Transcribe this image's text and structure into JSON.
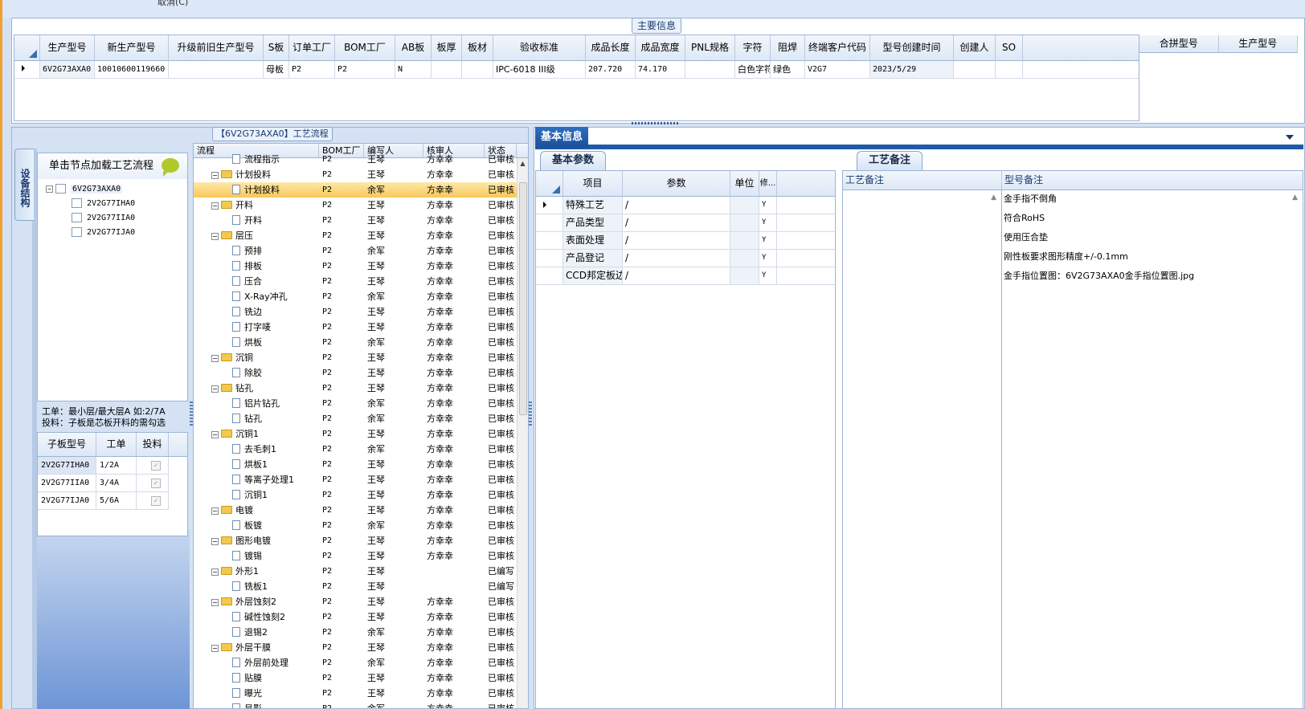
{
  "top": {
    "clipped_text": "取消(C)"
  },
  "main_info": {
    "group_title": "主要信息",
    "columns": [
      "生产型号",
      "新生产型号",
      "升级前旧生产型号",
      "S板",
      "订单工厂",
      "BOM工厂",
      "AB板",
      "板厚",
      "板材",
      "验收标准",
      "成品长度",
      "成品宽度",
      "PNL规格",
      "字符",
      "阻焊",
      "终端客户代码",
      "型号创建时间",
      "创建人",
      "SO"
    ],
    "row": [
      "6V2G73AXA0",
      "10010600119660",
      "",
      "母板",
      "P2",
      "P2",
      "N",
      "",
      "",
      "IPC-6018 III级",
      "207.720",
      "74.170",
      "",
      "白色字符",
      "绿色",
      "V2G7",
      "2023/5/29",
      "",
      ""
    ]
  },
  "merge": {
    "columns": [
      "合拼型号",
      "生产型号"
    ]
  },
  "left": {
    "side_tab": "设备结构",
    "flow_title": "【6V2G73AXA0】工艺流程",
    "node_hint": "单击节点加载工艺流程",
    "tree": {
      "root": "6V2G73AXA0",
      "children": [
        "2V2G77IHA0",
        "2V2G77IIA0",
        "2V2G77IJA0"
      ]
    },
    "notes": [
      "工单：最小层/最大层A 如:2/7A",
      "投料：子板是芯板开料的需勾选"
    ],
    "sub_columns": [
      "子板型号",
      "工单",
      "投料"
    ],
    "sub_rows": [
      {
        "model": "2V2G77IHA0",
        "order": "1/2A",
        "check": "✓"
      },
      {
        "model": "2V2G77IIA0",
        "order": "3/4A",
        "check": "✓"
      },
      {
        "model": "2V2G77IJA0",
        "order": "5/6A",
        "check": "✓"
      }
    ]
  },
  "flow": {
    "columns": [
      "流程",
      "BOM工厂",
      "编写人",
      "核审人",
      "状态"
    ],
    "rows": [
      {
        "name": "流程指示",
        "type": "doc",
        "bom": "P2",
        "writer": "王琴",
        "reviewer": "方幸幸",
        "status": "已审核"
      },
      {
        "name": "计划投料",
        "type": "folder",
        "bom": "P2",
        "writer": "王琴",
        "reviewer": "方幸幸",
        "status": "已审核"
      },
      {
        "name": "计划投料",
        "type": "doc",
        "bom": "P2",
        "writer": "余军",
        "reviewer": "方幸幸",
        "status": "已审核",
        "hl": true
      },
      {
        "name": "开料",
        "type": "folder",
        "bom": "P2",
        "writer": "王琴",
        "reviewer": "方幸幸",
        "status": "已审核"
      },
      {
        "name": "开料",
        "type": "doc",
        "bom": "P2",
        "writer": "王琴",
        "reviewer": "方幸幸",
        "status": "已审核"
      },
      {
        "name": "层压",
        "type": "folder",
        "bom": "P2",
        "writer": "王琴",
        "reviewer": "方幸幸",
        "status": "已审核"
      },
      {
        "name": "预排",
        "type": "doc",
        "bom": "P2",
        "writer": "余军",
        "reviewer": "方幸幸",
        "status": "已审核"
      },
      {
        "name": "排板",
        "type": "doc",
        "bom": "P2",
        "writer": "王琴",
        "reviewer": "方幸幸",
        "status": "已审核"
      },
      {
        "name": "压合",
        "type": "doc",
        "bom": "P2",
        "writer": "王琴",
        "reviewer": "方幸幸",
        "status": "已审核"
      },
      {
        "name": "X-Ray冲孔",
        "type": "doc",
        "bom": "P2",
        "writer": "余军",
        "reviewer": "方幸幸",
        "status": "已审核"
      },
      {
        "name": "铣边",
        "type": "doc",
        "bom": "P2",
        "writer": "王琴",
        "reviewer": "方幸幸",
        "status": "已审核"
      },
      {
        "name": "打字唛",
        "type": "doc",
        "bom": "P2",
        "writer": "王琴",
        "reviewer": "方幸幸",
        "status": "已审核"
      },
      {
        "name": "烘板",
        "type": "doc",
        "bom": "P2",
        "writer": "余军",
        "reviewer": "方幸幸",
        "status": "已审核"
      },
      {
        "name": "沉铜",
        "type": "folder",
        "bom": "P2",
        "writer": "王琴",
        "reviewer": "方幸幸",
        "status": "已审核"
      },
      {
        "name": "除胶",
        "type": "doc",
        "bom": "P2",
        "writer": "王琴",
        "reviewer": "方幸幸",
        "status": "已审核"
      },
      {
        "name": "钻孔",
        "type": "folder",
        "bom": "P2",
        "writer": "王琴",
        "reviewer": "方幸幸",
        "status": "已审核"
      },
      {
        "name": "铝片钻孔",
        "type": "doc",
        "bom": "P2",
        "writer": "余军",
        "reviewer": "方幸幸",
        "status": "已审核"
      },
      {
        "name": "钻孔",
        "type": "doc",
        "bom": "P2",
        "writer": "余军",
        "reviewer": "方幸幸",
        "status": "已审核"
      },
      {
        "name": "沉铜1",
        "type": "folder",
        "bom": "P2",
        "writer": "王琴",
        "reviewer": "方幸幸",
        "status": "已审核"
      },
      {
        "name": "去毛刺1",
        "type": "doc",
        "bom": "P2",
        "writer": "余军",
        "reviewer": "方幸幸",
        "status": "已审核"
      },
      {
        "name": "烘板1",
        "type": "doc",
        "bom": "P2",
        "writer": "王琴",
        "reviewer": "方幸幸",
        "status": "已审核"
      },
      {
        "name": "等离子处理1",
        "type": "doc",
        "bom": "P2",
        "writer": "王琴",
        "reviewer": "方幸幸",
        "status": "已审核"
      },
      {
        "name": "沉铜1",
        "type": "doc",
        "bom": "P2",
        "writer": "王琴",
        "reviewer": "方幸幸",
        "status": "已审核"
      },
      {
        "name": "电镀",
        "type": "folder",
        "bom": "P2",
        "writer": "王琴",
        "reviewer": "方幸幸",
        "status": "已审核"
      },
      {
        "name": "板镀",
        "type": "doc",
        "bom": "P2",
        "writer": "余军",
        "reviewer": "方幸幸",
        "status": "已审核"
      },
      {
        "name": "图形电镀",
        "type": "folder",
        "bom": "P2",
        "writer": "王琴",
        "reviewer": "方幸幸",
        "status": "已审核"
      },
      {
        "name": "镀锡",
        "type": "doc",
        "bom": "P2",
        "writer": "王琴",
        "reviewer": "方幸幸",
        "status": "已审核"
      },
      {
        "name": "外形1",
        "type": "folder",
        "bom": "P2",
        "writer": "王琴",
        "reviewer": "",
        "status": "已编写"
      },
      {
        "name": "铣板1",
        "type": "doc",
        "bom": "P2",
        "writer": "王琴",
        "reviewer": "",
        "status": "已编写"
      },
      {
        "name": "外层蚀刻2",
        "type": "folder",
        "bom": "P2",
        "writer": "王琴",
        "reviewer": "方幸幸",
        "status": "已审核"
      },
      {
        "name": "碱性蚀刻2",
        "type": "doc",
        "bom": "P2",
        "writer": "王琴",
        "reviewer": "方幸幸",
        "status": "已审核"
      },
      {
        "name": "退锡2",
        "type": "doc",
        "bom": "P2",
        "writer": "余军",
        "reviewer": "方幸幸",
        "status": "已审核"
      },
      {
        "name": "外层干膜",
        "type": "folder",
        "bom": "P2",
        "writer": "王琴",
        "reviewer": "方幸幸",
        "status": "已审核"
      },
      {
        "name": "外层前处理",
        "type": "doc",
        "bom": "P2",
        "writer": "余军",
        "reviewer": "方幸幸",
        "status": "已审核"
      },
      {
        "name": "贴膜",
        "type": "doc",
        "bom": "P2",
        "writer": "王琴",
        "reviewer": "方幸幸",
        "status": "已审核"
      },
      {
        "name": "曝光",
        "type": "doc",
        "bom": "P2",
        "writer": "王琴",
        "reviewer": "方幸幸",
        "status": "已审核"
      },
      {
        "name": "显影",
        "type": "doc",
        "bom": "P2",
        "writer": "余军",
        "reviewer": "方幸幸",
        "status": "已审核"
      }
    ]
  },
  "right": {
    "main_tab": "基本信息",
    "param_tab": "基本参数",
    "note_tab": "工艺备注",
    "param_columns": [
      "项目",
      "参数",
      "单位",
      "修..."
    ],
    "params": [
      {
        "item": "特殊工艺",
        "value": "/",
        "unit": "",
        "mod": "Y"
      },
      {
        "item": "产品类型",
        "value": "/",
        "unit": "",
        "mod": "Y"
      },
      {
        "item": "表面处理",
        "value": "/",
        "unit": "",
        "mod": "Y"
      },
      {
        "item": "产品登记",
        "value": "/",
        "unit": "",
        "mod": "Y"
      },
      {
        "item": "CCD邦定板边",
        "value": "/",
        "unit": "",
        "mod": "Y"
      }
    ],
    "note_columns": [
      "工艺备注",
      "型号备注"
    ],
    "model_notes": [
      "金手指不倒角",
      "符合RoHS",
      "使用压合垫",
      "刚性板要求图形精度+/-0.1mm",
      "金手指位置图：6V2G73AXA0金手指位置图.jpg"
    ]
  }
}
